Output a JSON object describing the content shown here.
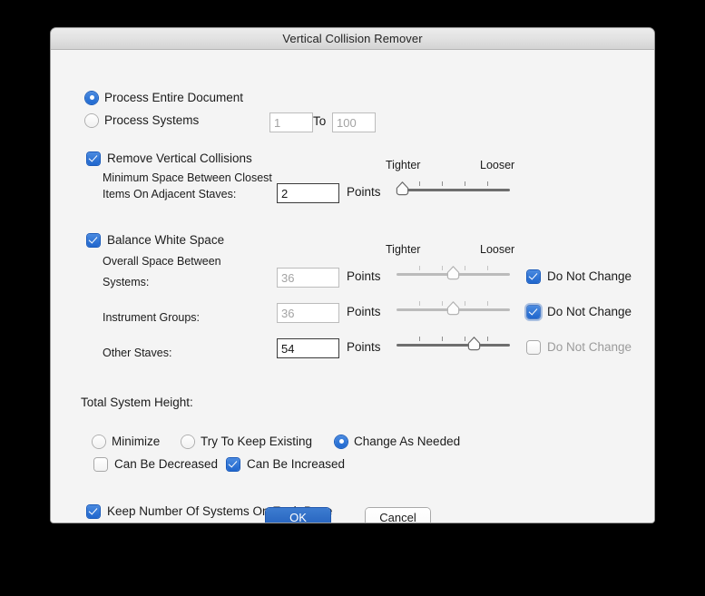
{
  "window": {
    "title": "Vertical Collision Remover"
  },
  "scope": {
    "entire_document": {
      "label": "Process Entire Document",
      "selected": true
    },
    "systems": {
      "label": "Process Systems",
      "selected": false,
      "from_value": "1",
      "to_label": "To",
      "to_value": "100"
    }
  },
  "remove_collisions": {
    "label": "Remove Vertical Collisions",
    "checked": true,
    "desc_line1": "Minimum Space Between Closest",
    "desc_line2": "Items On Adjacent Staves:",
    "value": "2",
    "units": "Points",
    "slider": {
      "tighter_label": "Tighter",
      "looser_label": "Looser",
      "position_percent": 0,
      "enabled": true,
      "tick_count": 4
    }
  },
  "balance_white_space": {
    "label": "Balance White Space",
    "checked": true,
    "subtitle": "Overall Space Between",
    "tighter_label": "Tighter",
    "looser_label": "Looser",
    "units": "Points",
    "do_not_change_label": "Do Not Change",
    "rows": [
      {
        "label": "Systems:",
        "value": "36",
        "value_enabled": false,
        "slider_percent": 50,
        "slider_enabled": false,
        "do_not_change": true,
        "focused": false
      },
      {
        "label": "Instrument Groups:",
        "value": "36",
        "value_enabled": false,
        "slider_percent": 50,
        "slider_enabled": false,
        "do_not_change": true,
        "focused": true
      },
      {
        "label": "Other Staves:",
        "value": "54",
        "value_enabled": true,
        "slider_percent": 70,
        "slider_enabled": true,
        "do_not_change": false,
        "focused": false
      }
    ]
  },
  "total_system_height": {
    "label": "Total System Height:",
    "options": [
      {
        "label": "Minimize",
        "selected": false
      },
      {
        "label": "Try To Keep Existing",
        "selected": false
      },
      {
        "label": "Change As Needed",
        "selected": true
      }
    ],
    "can_be_decreased": {
      "label": "Can Be Decreased",
      "checked": false
    },
    "can_be_increased": {
      "label": "Can Be Increased",
      "checked": true
    }
  },
  "keep_systems": {
    "label": "Keep Number Of Systems On Each Page",
    "checked": true
  },
  "buttons": {
    "ok": "OK",
    "cancel": "Cancel"
  },
  "colors": {
    "accent": "#2461bd",
    "window_bg": "#f4f4f4",
    "titlebar": "#e2e2e2",
    "disabled_text": "#a3a3a3"
  }
}
